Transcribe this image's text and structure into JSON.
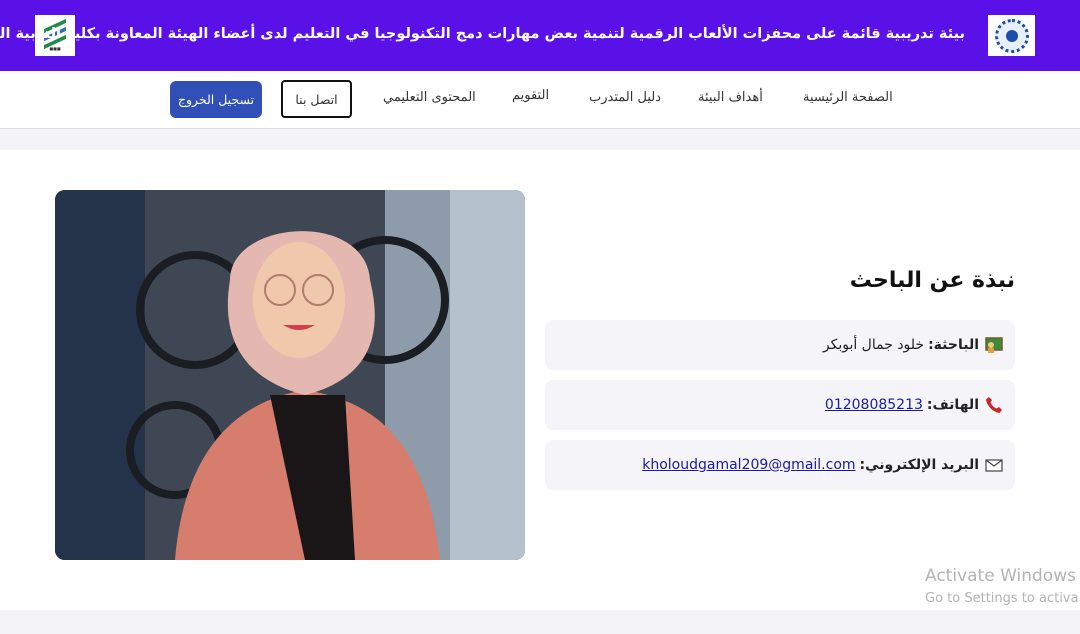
{
  "header": {
    "title": "بيئة تدريبية قائمة على محفزات الألعاب الرقمية لتنمية بعض مهارات دمج التكنولوجيا في التعليم لدى أعضاء الهيئة المعاونة بكلية التربية النوعية",
    "left_logo_icon": "faculty-logo",
    "right_logo_icon": "university-seal-logo"
  },
  "nav": {
    "items": [
      {
        "label": "الصفحة الرئيسية"
      },
      {
        "label": "أهداف البيئة"
      },
      {
        "label": "دليل المتدرب"
      },
      {
        "label": "التقويم"
      },
      {
        "label": "المحتوى التعليمي"
      }
    ],
    "contact_label": "اتصل بنا",
    "logout_label": "تسجيل الخروج"
  },
  "about": {
    "title": "نبذة عن الباحث",
    "researcher": {
      "icon": "teacher-icon",
      "label": "الباحثة:",
      "value": "خلود جمال أبوبكر"
    },
    "phone": {
      "icon": "phone-icon",
      "label": "الهاتف:",
      "value": "01208085213"
    },
    "email": {
      "icon": "envelope-icon",
      "label": "البريد الإلكتروني:",
      "value": "kholoudgamal209@gmail.com"
    }
  },
  "os_watermark": {
    "line1": "Activate Windows",
    "line2": "Go to Settings to activa"
  },
  "colors": {
    "header_bg": "#5a11e8",
    "logout_bg": "#3050b7",
    "link": "#1a1aa6"
  }
}
